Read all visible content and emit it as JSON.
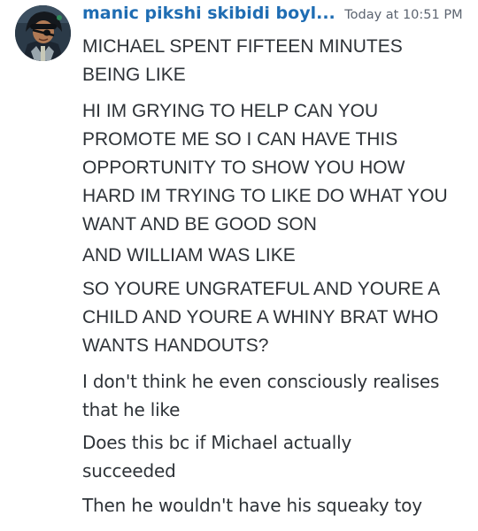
{
  "message": {
    "author": "manic pikshi skibidi boyl...",
    "timestamp": "Today at 10:51 PM",
    "lines": [
      "MICHAEL SPENT FIFTEEN MINUTES\nBEING LIKE",
      "HI IM GRYING TO HELP CAN YOU\nPROMOTE ME SO I CAN HAVE THIS\nOPPORTUNITY TO SHOW YOU HOW\nHARD IM TRYING TO LIKE DO WHAT YOU\nWANT AND BE GOOD SON",
      "AND WILLIAM WAS LIKE",
      "SO YOURE UNGRATEFUL AND YOURE A\nCHILD AND YOURE A WHINY BRAT WHO\nWANTS HANDOUTS?",
      "I don't think he even consciously realises\nthat he like",
      "Does this bc if Michael actually\nsucceeded",
      "Then he wouldn't have his squeaky toy"
    ]
  },
  "colors": {
    "username": "#1f6db3",
    "timestamp": "#5c6470",
    "text": "#2e3338",
    "background": "#ffffff"
  },
  "icons": {
    "avatar": "avatar-icon"
  }
}
